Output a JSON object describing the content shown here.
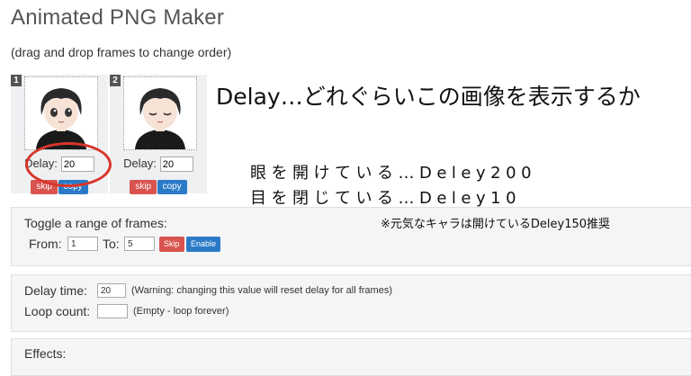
{
  "page": {
    "title": "Animated PNG Maker",
    "subtitle": "(drag and drop frames to change order)"
  },
  "frames": [
    {
      "number": "1",
      "delay_label": "Delay:",
      "delay_value": "20",
      "skip_label": "skip",
      "copy_label": "copy"
    },
    {
      "number": "2",
      "delay_label": "Delay:",
      "delay_value": "20",
      "skip_label": "skip",
      "copy_label": "copy"
    }
  ],
  "annotation": {
    "main": "Delay…どれぐらいこの画像を表示するか",
    "line1": "眼を開けている…Deley200",
    "line2": "目を閉じている…Deley10",
    "note": "※元気なキャラは開けているDeley150推奨"
  },
  "toggle": {
    "title": "Toggle a range of frames:",
    "from_label": "From:",
    "from_value": "1",
    "to_label": "To:",
    "to_value": "5",
    "skip_label": "Skip",
    "enable_label": "Enable"
  },
  "settings": {
    "delay_label": "Delay time:",
    "delay_value": "20",
    "delay_hint": "(Warning: changing this value will reset delay for all frames)",
    "loop_label": "Loop count:",
    "loop_value": "",
    "loop_hint": "(Empty - loop forever)"
  },
  "effects": {
    "title": "Effects:"
  },
  "colors": {
    "accent_red": "#d9534f",
    "accent_blue": "#2a7ac8",
    "highlight_circle": "#d9352b"
  }
}
